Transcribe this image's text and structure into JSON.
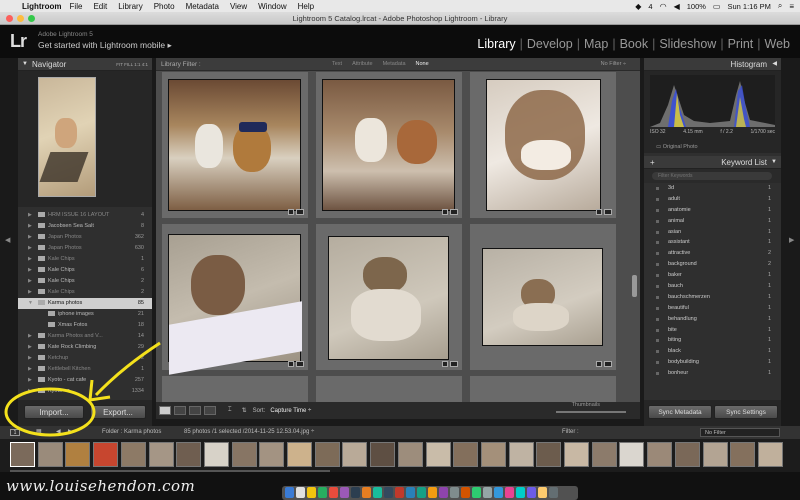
{
  "menubar": {
    "app_name": "Lightroom",
    "items": [
      "File",
      "Edit",
      "Library",
      "Photo",
      "Metadata",
      "View",
      "Window",
      "Help"
    ],
    "battery": "100%",
    "clock": "Sun 1:16 PM",
    "status_number": "4"
  },
  "window": {
    "title": "Lightroom 5 Catalog.lrcat - Adobe Photoshop Lightroom - Library"
  },
  "identity": {
    "logo": "Lr",
    "product": "Adobe Lightroom 5",
    "tagline": "Get started with Lightroom mobile"
  },
  "modules": [
    "Library",
    "Develop",
    "Map",
    "Book",
    "Slideshow",
    "Print",
    "Web"
  ],
  "active_module": "Library",
  "navigator": {
    "title": "Navigator",
    "options": "FIT  FILL  1:1  4:1"
  },
  "folders": [
    {
      "label": "HRM ISSUE 16 LAYOUT",
      "count": "4",
      "state": "dim"
    },
    {
      "label": "Jacobsen Sea Salt",
      "count": "8",
      "state": "normal"
    },
    {
      "label": "Japan Photos",
      "count": "362",
      "state": "dim"
    },
    {
      "label": "Japan Photos",
      "count": "630",
      "state": "dim"
    },
    {
      "label": "Kale Chips",
      "count": "1",
      "state": "dim"
    },
    {
      "label": "Kale Chips",
      "count": "6",
      "state": "normal"
    },
    {
      "label": "Kale Chips",
      "count": "2",
      "state": "normal"
    },
    {
      "label": "Kale Chips",
      "count": "2",
      "state": "dim"
    },
    {
      "label": "Karma photos",
      "count": "85",
      "state": "sel"
    },
    {
      "label": "iphone images",
      "count": "21",
      "state": "sub"
    },
    {
      "label": "Xmas Fotos",
      "count": "18",
      "state": "sub"
    },
    {
      "label": "Karma Photos and V...",
      "count": "14",
      "state": "dim"
    },
    {
      "label": "Kate Rock Climbing",
      "count": "29",
      "state": "normal"
    },
    {
      "label": "Ketchup",
      "count": "2",
      "state": "dim"
    },
    {
      "label": "Kettlebell Kitchen",
      "count": "1",
      "state": "dim"
    },
    {
      "label": "Kyoto - cat cafe",
      "count": "257",
      "state": "normal"
    },
    {
      "label": "Kyoto - s...",
      "count": "1334",
      "state": "normal"
    }
  ],
  "left_buttons": {
    "import": "Import...",
    "export": "Export..."
  },
  "filterbar": {
    "label": "Library Filter :",
    "options": [
      "Text",
      "Attribute",
      "Metadata",
      "None"
    ],
    "active": "None",
    "preset": "No Filter ÷"
  },
  "toolbar": {
    "sort_label": "Sort:",
    "sort_value": "Capture Time ÷",
    "thumbnails": "Thumbnails"
  },
  "histogram": {
    "title": "Histogram",
    "iso": "ISO 32",
    "focal": "4.15 mm",
    "aperture": "f / 2.2",
    "shutter": "1/1700 sec",
    "original": "Original Photo"
  },
  "keywords": {
    "title": "Keyword List",
    "placeholder": "Filter Keywords",
    "items": [
      {
        "label": "3d",
        "count": "1"
      },
      {
        "label": "adult",
        "count": "1"
      },
      {
        "label": "anatomie",
        "count": "1"
      },
      {
        "label": "animal",
        "count": "1"
      },
      {
        "label": "asian",
        "count": "1"
      },
      {
        "label": "assistant",
        "count": "1"
      },
      {
        "label": "attractive",
        "count": "2"
      },
      {
        "label": "background",
        "count": "2"
      },
      {
        "label": "baker",
        "count": "1"
      },
      {
        "label": "bauch",
        "count": "1"
      },
      {
        "label": "bauchschmerzen",
        "count": "1"
      },
      {
        "label": "beautiful",
        "count": "1"
      },
      {
        "label": "behandlung",
        "count": "1"
      },
      {
        "label": "bite",
        "count": "1"
      },
      {
        "label": "biting",
        "count": "1"
      },
      {
        "label": "black",
        "count": "1"
      },
      {
        "label": "bodybuilding",
        "count": "1"
      },
      {
        "label": "bonheur",
        "count": "1"
      }
    ]
  },
  "right_buttons": {
    "sync_metadata": "Sync Metadata",
    "sync_settings": "Sync Settings"
  },
  "filmstrip_header": {
    "page": "1",
    "folder": "Folder : Karma photos",
    "count": "85 photos /1 selected /2014-11-25 12.53.04.jpg ÷",
    "filter_label": "Filter :",
    "filter_value": "No Filter"
  },
  "watermark": "www.louisehendon.com",
  "colors": {
    "annotation": "#f4e11c",
    "selected_row": "#cfcfcf"
  }
}
